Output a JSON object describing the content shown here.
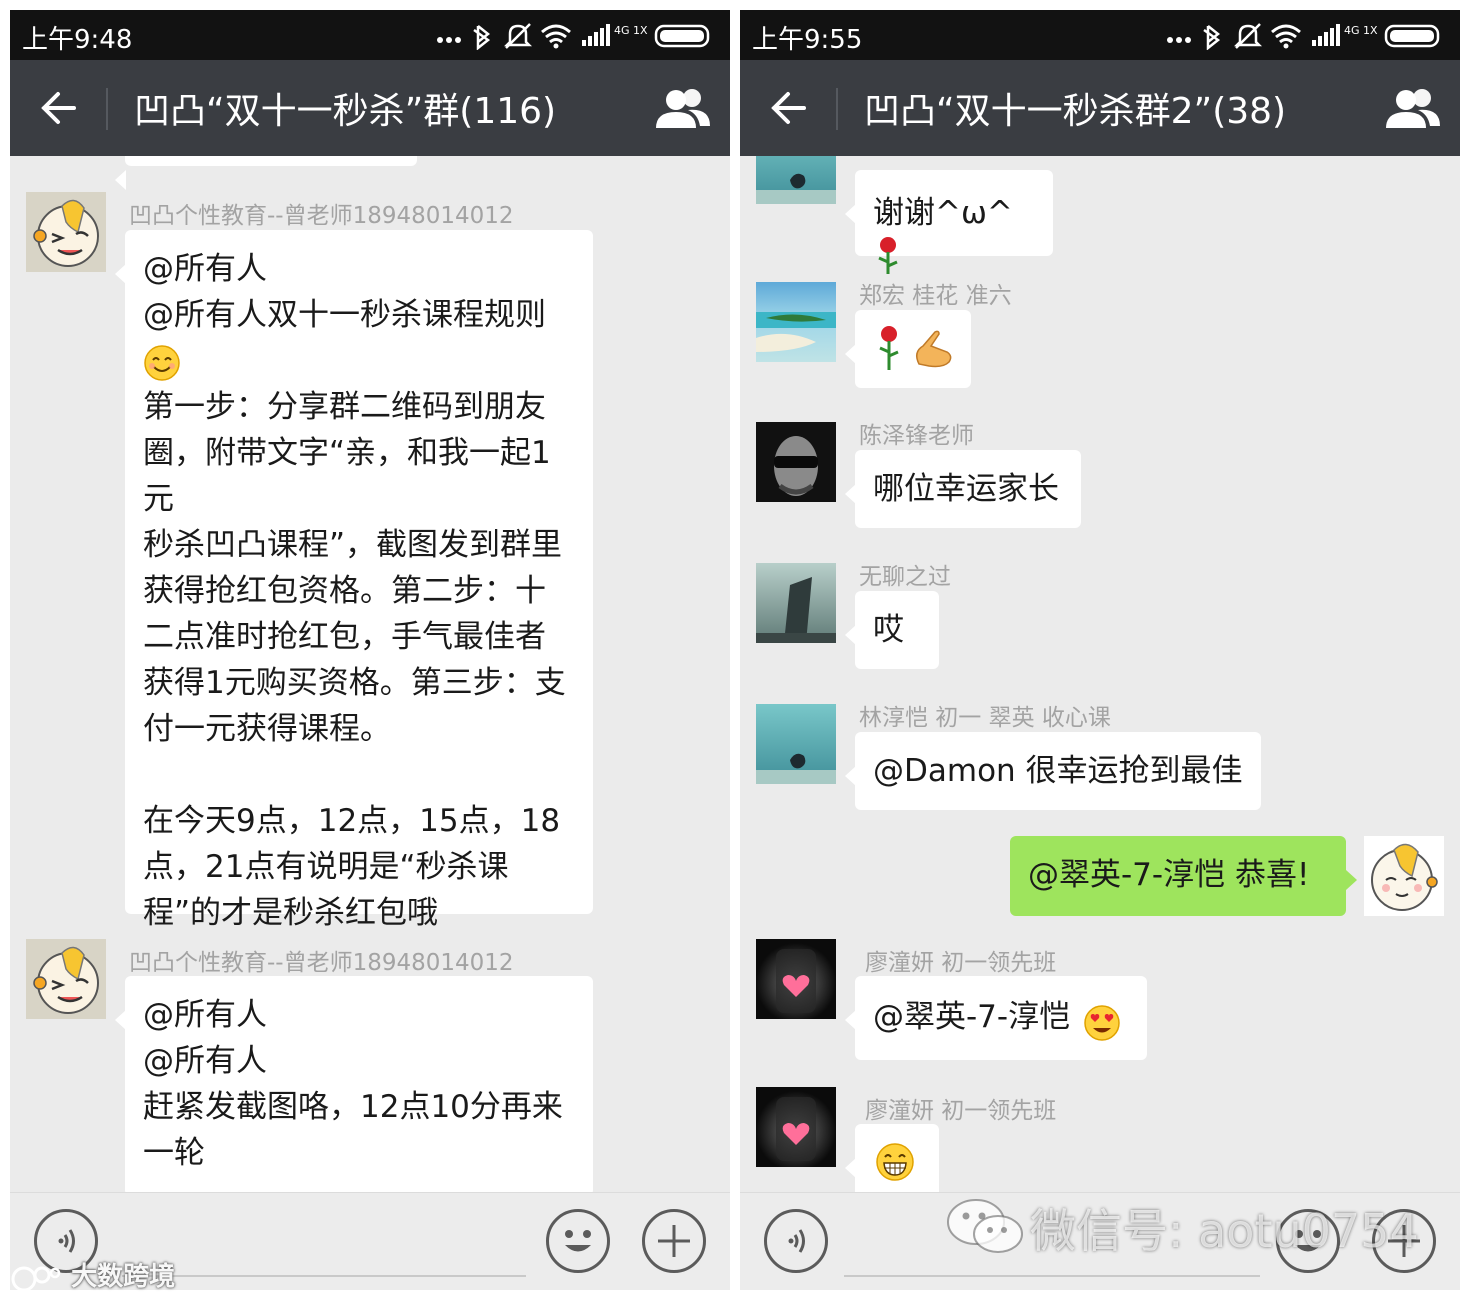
{
  "left_screen": {
    "status": {
      "time": "上午9:48",
      "network": "4G 1X"
    },
    "header": {
      "title": "凹凸“双十一秒杀”群(116)"
    },
    "messages": [
      {
        "sender": "凹凸个性教育--曾老师18948014012",
        "lines": [
          "@所有人",
          "@所有人双十一秒杀课程规则",
          "[smile]",
          "第一步：分享群二维码到朋友",
          "圈，附带文字“亲，和我一起1元",
          "秒杀凹凸课程”，截图发到群里",
          "获得抢红包资格。第二步：十",
          "二点准时抢红包，手气最佳者",
          "获得1元购买资格。第三步：支",
          "付一元获得课程。",
          "",
          "在今天9点，12点，15点，18",
          "点，21点有说明是“秒杀课",
          "程”的才是秒杀红包哦"
        ]
      },
      {
        "sender": "凹凸个性教育--曾老师18948014012",
        "lines": [
          "@所有人",
          "@所有人",
          "赶紧发截图咯，12点10分再来",
          "一轮"
        ]
      }
    ]
  },
  "right_screen": {
    "status": {
      "time": "上午9:55",
      "network": "4G 1X"
    },
    "header": {
      "title": "凹凸“双十一秒杀群2”(38)"
    },
    "messages": [
      {
        "sender": "",
        "text": "谢谢^ω^",
        "emoji": "rose"
      },
      {
        "sender": "郑宏 桂花 准六",
        "text": "",
        "emoji": "rose, ok-hand"
      },
      {
        "sender": "陈泽锋老师",
        "text": "哪位幸运家长"
      },
      {
        "sender": "无聊之过",
        "text": "哎"
      },
      {
        "sender": "林淳恺 初一 翠英 收心课",
        "text": "@Damon 很幸运抢到最佳"
      },
      {
        "sender": "self",
        "text": "@翠英-7-淳恺 恭喜!"
      },
      {
        "sender": "廖潼妍 初一领先班",
        "text": "@翠英-7-淳恺",
        "emoji": "heart-eyes"
      },
      {
        "sender": "廖潼妍 初一领先班",
        "text": "",
        "emoji": "grin"
      }
    ]
  },
  "watermarks": {
    "left": "大数跨境",
    "right": "微信号: aotu0754"
  },
  "colors": {
    "title_bar": "#3a3d42",
    "status_bar": "#121212",
    "chat_bg": "#ebebeb",
    "self_bubble": "#9ee45d",
    "sender_text": "#a3a3a3"
  },
  "icons": [
    "back-arrow-icon",
    "group-members-icon",
    "voice-icon",
    "emoji-icon",
    "plus-icon",
    "bluetooth-icon",
    "mute-icon",
    "wifi-icon",
    "signal-icon",
    "battery-icon",
    "wechat-logo-icon"
  ]
}
